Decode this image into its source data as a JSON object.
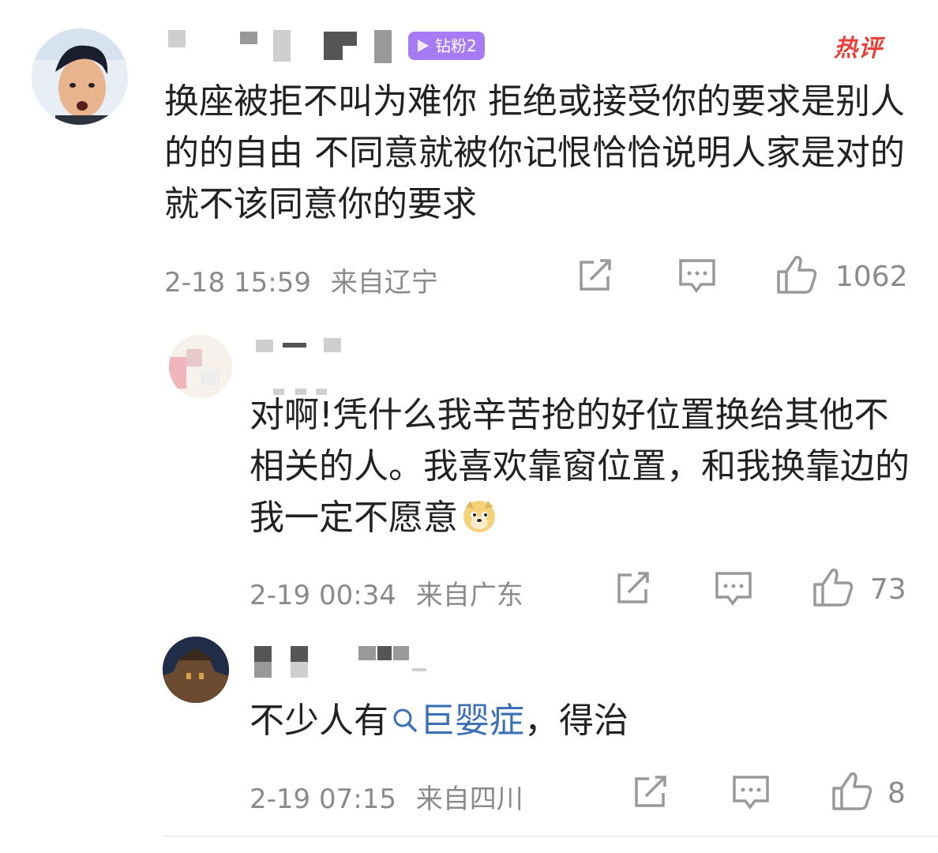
{
  "hot_label": "热评",
  "comments": [
    {
      "badge": "钻粉2",
      "text": "换座被拒不叫为难你 拒绝或接受你的要求是别人的的自由 不同意就被你记恨恰恰说明人家是对的 就不该同意你的要求",
      "time": "2-18 15:59",
      "location": "来自辽宁",
      "likes": "1062"
    },
    {
      "text": "对啊!凭什么我辛苦抢的好位置换给其他不相关的人。我喜欢靠窗位置，和我换靠边的我一定不愿意",
      "time": "2-19 00:34",
      "location": "来自广东",
      "likes": "73"
    },
    {
      "text_before": "不少人有",
      "topic": "巨婴症",
      "text_after": "，得治",
      "time": "2-19 07:15",
      "location": "来自四川",
      "likes": "8"
    }
  ],
  "colors": {
    "accent_topic": "#3b6fb6",
    "hot": "#e8413a",
    "badge": "#a67bf3",
    "meta": "#8a8a8a"
  }
}
